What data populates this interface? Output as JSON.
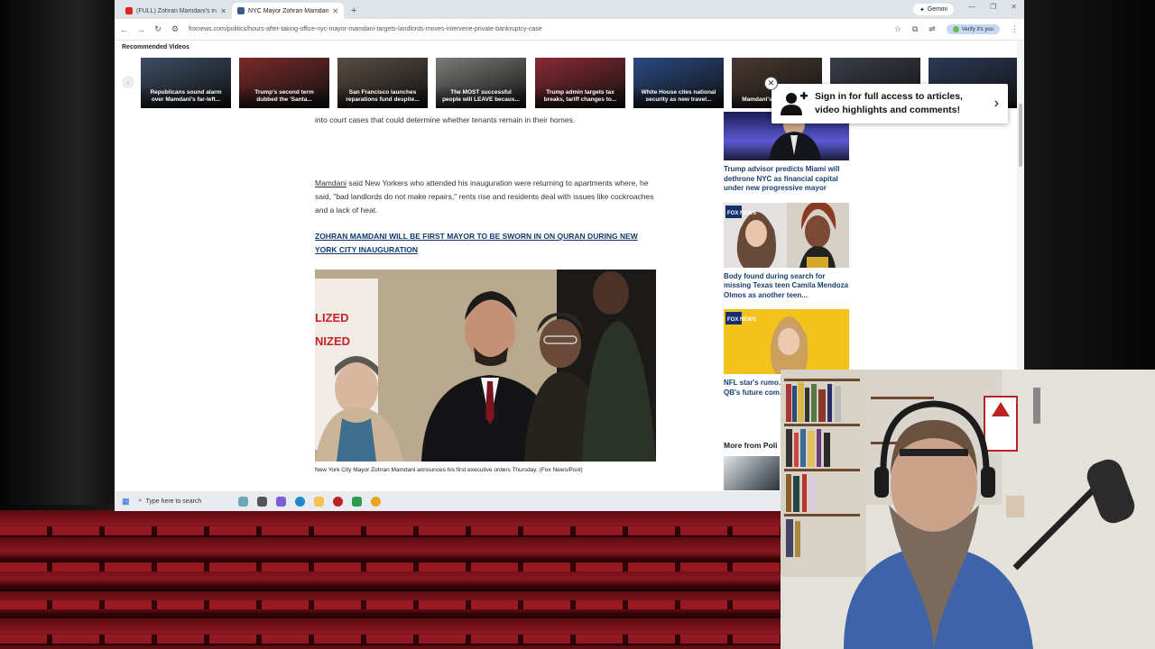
{
  "browser": {
    "tabs": [
      {
        "title": "(FULL) Zohran Mamdani's inaugu...",
        "favicon_color": "#e32020",
        "active": false
      },
      {
        "title": "NYC Mayor Zohran Mamdani t...",
        "favicon_color": "#3a5a8c",
        "active": true
      }
    ],
    "new_tab": "+",
    "gemini_label": "Gemini",
    "url": "foxnews.com/politics/hours-after-taking-office-nyc-mayor-mamdani-targets-landlords-moves-intervene-private-bankruptcy-case",
    "verify_label": "Verify it's you"
  },
  "recommended": {
    "title": "Recommended Videos",
    "videos": [
      {
        "caption": "Republicans sound alarm over Mamdani's far-left...",
        "bg": "#3c4d63"
      },
      {
        "caption": "Trump's second term dubbed the 'Santa...",
        "bg": "#7a2a2a"
      },
      {
        "caption": "San Francisco launches reparations fund despite...",
        "bg": "#5a4d44"
      },
      {
        "caption": "The MOST successful people will LEAVE becaus...",
        "bg": "#7b7b78"
      },
      {
        "caption": "Trump admin targets tax breaks, tariff changes to...",
        "bg": "#8a2a34"
      },
      {
        "caption": "White House cites national security as new travel...",
        "bg": "#2a4a82"
      },
      {
        "caption": "Mamdani's 'rugged indi...",
        "bg": "#4a3a30"
      },
      {
        "caption": "",
        "bg": "#3a3f4a"
      },
      {
        "caption": "",
        "bg": "#2c3a58"
      }
    ]
  },
  "signin": {
    "text_line1": "Sign in for full access to articles,",
    "text_line2": "video highlights and comments!"
  },
  "article": {
    "para1": "into court cases that could determine whether tenants remain in their homes.",
    "para2_link": "Mamdani",
    "para2_rest": " said New Yorkers who attended his inauguration were returning to apartments where, he said, \"bad landlords do not make repairs,\" rents rise and residents deal with issues like cockroaches and a lack of heat.",
    "related_headline": "ZOHRAN MAMDANI WILL BE FIRST MAYOR TO BE SWORN IN ON QURAN DURING NEW YORK CITY INAUGURATION",
    "sign_line1": "LIZED",
    "sign_line2": "NIZED",
    "photo_caption": "New York City Mayor Zohran Mamdani announces his first executive orders Thursday. (Fox News/Pool)"
  },
  "rail": {
    "cards": [
      {
        "title": "Trump advisor predicts Miami will dethrone NYC as financial capital under new progressive mayor"
      },
      {
        "title": "Body found during search for missing Texas teen Camila Mendoza Olmos as another teen..."
      },
      {
        "title": "NFL star's rumo... reflects on 'pret... QB's future com..."
      }
    ],
    "fox_badge": "FOX NEWS",
    "more_from": "More from Poli"
  },
  "taskbar": {
    "search_placeholder": "Type here to search"
  }
}
